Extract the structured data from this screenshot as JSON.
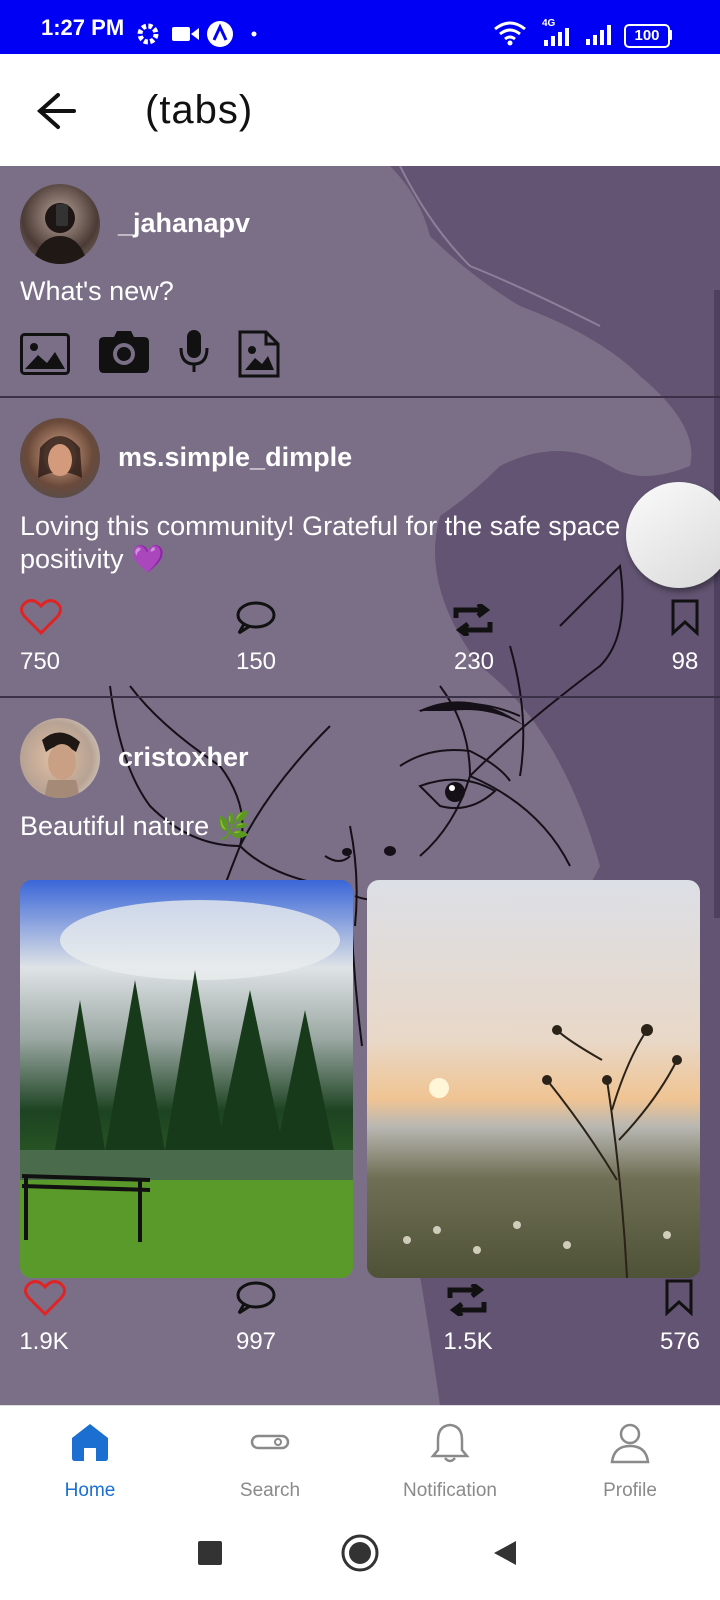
{
  "status_bar": {
    "time": "1:27 PM",
    "battery": "100",
    "network": "4G",
    "icons": [
      "gear-icon",
      "video-camera-icon",
      "a-badge-icon",
      "dot-icon",
      "wifi-icon",
      "signal-icon",
      "battery-icon"
    ]
  },
  "app_bar": {
    "title": "(tabs)",
    "back_icon": "arrow-left-icon"
  },
  "composer": {
    "username": "_jahanapv",
    "placeholder": "What's new?",
    "tools": [
      "gallery-icon",
      "camera-icon",
      "microphone-icon",
      "image-file-icon"
    ]
  },
  "posts": [
    {
      "username": "ms.simple_dimple",
      "text": "Loving this community! Grateful for the safe space",
      "text_line2": "positivity 💜",
      "likes": "750",
      "comments": "150",
      "reposts": "230",
      "saves": "98"
    },
    {
      "username": "cristoxher",
      "text": "Beautiful nature 🌿",
      "likes": "1.9K",
      "comments": "997",
      "reposts": "1.5K",
      "saves": "576"
    }
  ],
  "bottom_nav": {
    "items": [
      {
        "label": "Home",
        "icon": "home-icon",
        "active": true
      },
      {
        "label": "Search",
        "icon": "search-icon",
        "active": false
      },
      {
        "label": "Notification",
        "icon": "bell-icon",
        "active": false
      },
      {
        "label": "Profile",
        "icon": "user-icon",
        "active": false
      }
    ]
  },
  "colors": {
    "status_bar": "#0000f5",
    "content_bg": "#625472",
    "accent": "#1a6fd1",
    "like": "#e02424"
  },
  "system_nav": [
    "recents-square-icon",
    "home-circle-icon",
    "back-triangle-icon"
  ]
}
